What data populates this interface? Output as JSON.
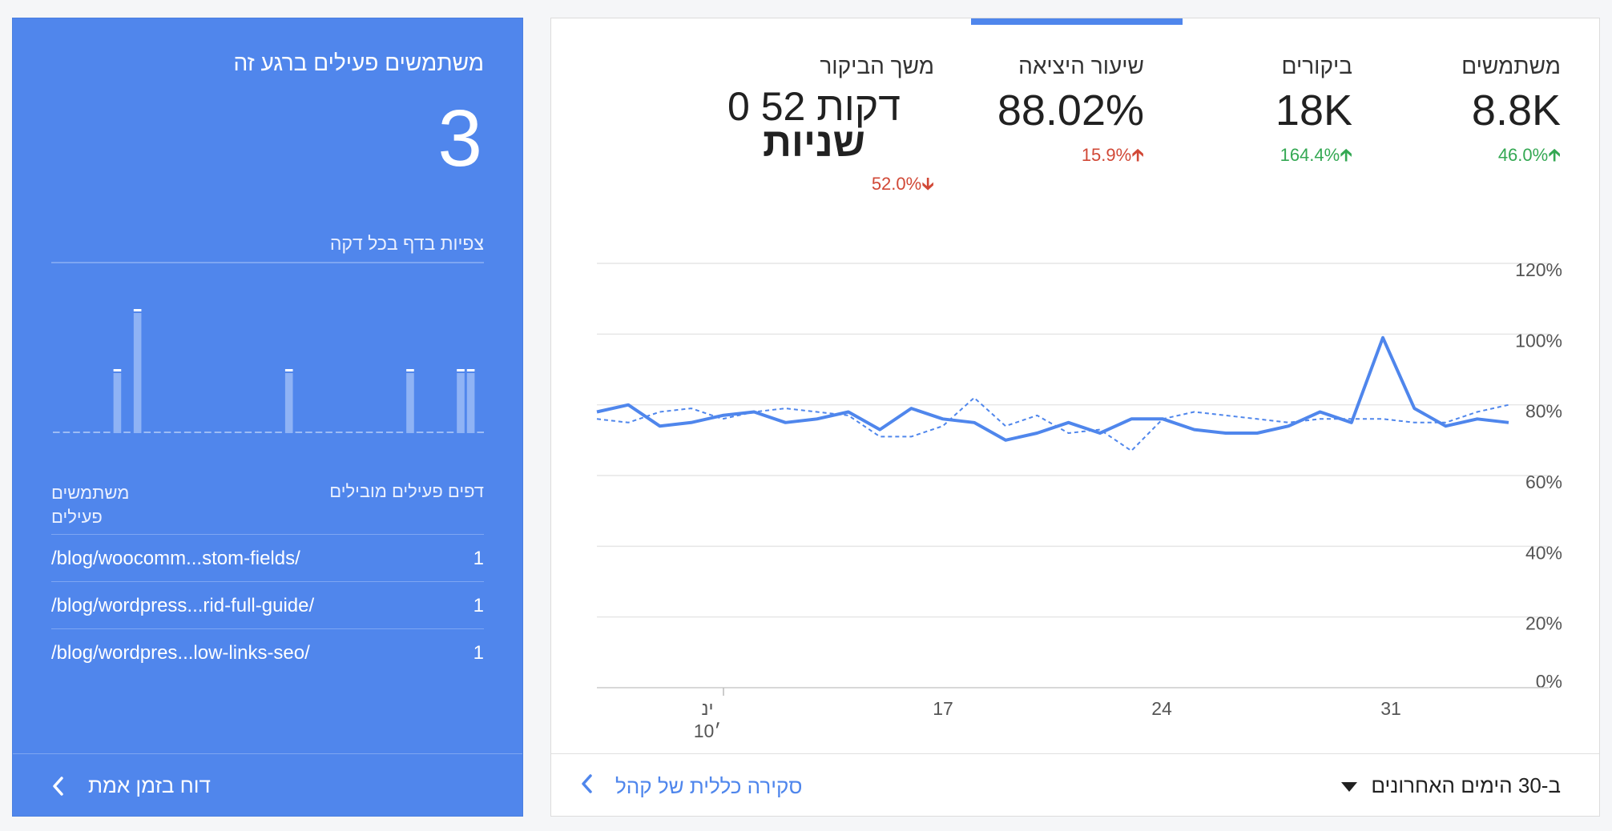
{
  "realtime": {
    "title": "משתמשים פעילים ברגע זה",
    "count": "3",
    "subtitle": "צפיות בדף בכל דקה",
    "bars": [
      0,
      0,
      0,
      0,
      0,
      0,
      0.5,
      0,
      1,
      0,
      0,
      0,
      0,
      0,
      0,
      0,
      0,
      0,
      0,
      0,
      0,
      0,
      0,
      0.5,
      0,
      0,
      0,
      0,
      0,
      0,
      0,
      0,
      0,
      0,
      0,
      0.5,
      0,
      0,
      0,
      0,
      0.5,
      0.5,
      0
    ],
    "header_pages": "דפים פעילים מובילים",
    "header_users_line1": "משתמשים",
    "header_users_line2": "פעילים",
    "rows": [
      {
        "path": "/blog/woocomm...stom-fields/",
        "value": "1"
      },
      {
        "path": "/blog/wordpress...rid-full-guide/",
        "value": "1"
      },
      {
        "path": "/blog/wordpres...low-links-seo/",
        "value": "1"
      }
    ],
    "footer_link": "דוח בזמן אמת"
  },
  "metrics": [
    {
      "label": "משתמשים",
      "value": "8.8K",
      "change": "46.0%",
      "direction": "up",
      "color": "#34a853"
    },
    {
      "label": "ביקורים",
      "value": "18K",
      "change": "164.4%",
      "direction": "up",
      "color": "#34a853"
    },
    {
      "label": "שיעור היציאה",
      "value": "88.02%",
      "change": "15.9%",
      "direction": "up",
      "color": "#d14836"
    },
    {
      "label": "משך הביקור",
      "value_line1": "0 דקות 52",
      "value_line2": "שניות",
      "change": "52.0%",
      "direction": "down",
      "color": "#d14836"
    }
  ],
  "chart_data": {
    "type": "line",
    "y_ticks": [
      "120%",
      "100%",
      "80%",
      "60%",
      "40%",
      "20%",
      "0%"
    ],
    "ylim": [
      0,
      120
    ],
    "x_tick_labels": [
      {
        "label_line1": "ינ",
        "label_line2": "׳10"
      },
      {
        "label_line1": "17"
      },
      {
        "label_line1": "24"
      },
      {
        "label_line1": "31"
      }
    ],
    "series": [
      {
        "style": "solid",
        "values": [
          78,
          80,
          74,
          75,
          77,
          78,
          75,
          76,
          78,
          73,
          79,
          76,
          75,
          70,
          72,
          75,
          72,
          76,
          76,
          73,
          72,
          72,
          74,
          78,
          75,
          99,
          79,
          74,
          76,
          75
        ]
      },
      {
        "style": "dashed",
        "values": [
          76,
          75,
          78,
          79,
          76,
          78,
          79,
          78,
          77,
          71,
          71,
          74,
          82,
          74,
          77,
          72,
          73,
          67,
          76,
          78,
          77,
          76,
          75,
          76,
          76,
          76,
          75,
          75,
          78,
          80
        ]
      }
    ],
    "grid": true,
    "line_color": "#4f86ec"
  },
  "footer": {
    "date_range": "ב-30 הימים האחרונים",
    "overview_link": "סקירה כללית של קהל"
  }
}
